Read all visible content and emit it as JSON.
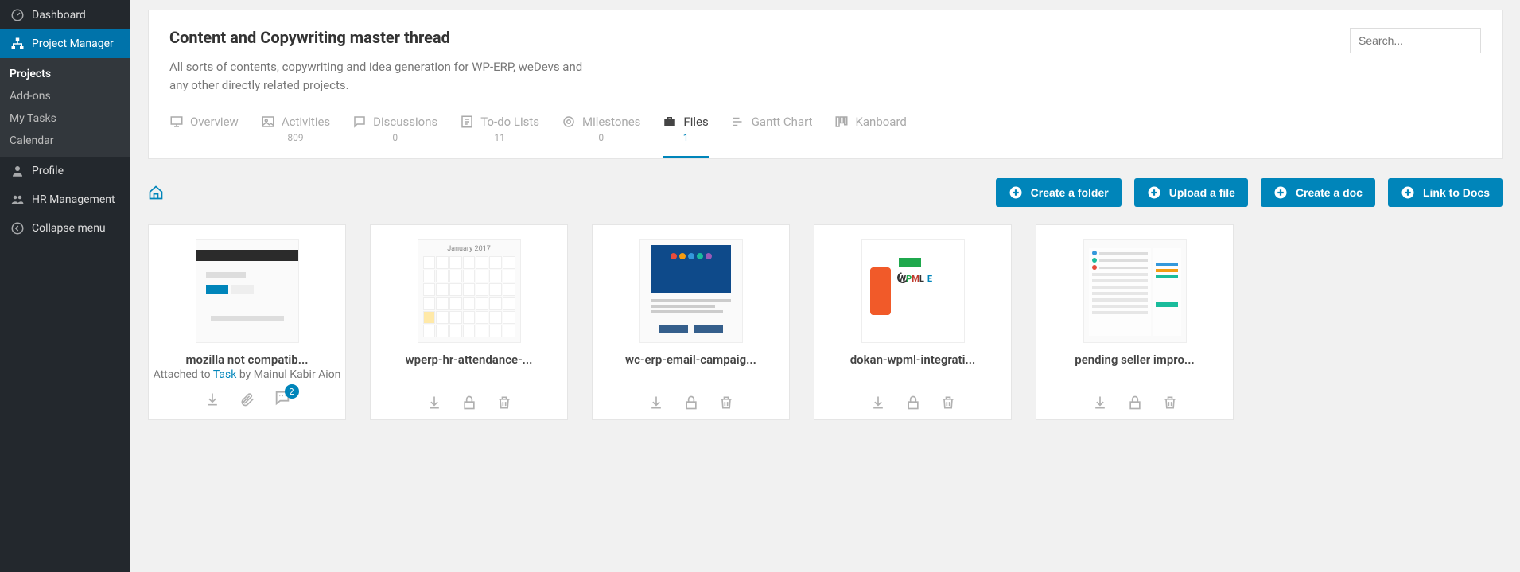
{
  "sidebar": {
    "items": [
      {
        "label": "Dashboard"
      },
      {
        "label": "Project Manager"
      },
      {
        "label": "Profile"
      },
      {
        "label": "HR Management"
      },
      {
        "label": "Collapse menu"
      }
    ],
    "submenu": {
      "items": [
        {
          "label": "Projects"
        },
        {
          "label": "Add-ons"
        },
        {
          "label": "My Tasks"
        },
        {
          "label": "Calendar"
        }
      ]
    }
  },
  "header": {
    "title": "Content and Copywriting master thread",
    "description": "All sorts of contents, copywriting and idea generation for WP-ERP, weDevs and any other directly related projects.",
    "search_placeholder": "Search..."
  },
  "tabs": [
    {
      "label": "Overview",
      "count": ""
    },
    {
      "label": "Activities",
      "count": "809"
    },
    {
      "label": "Discussions",
      "count": "0"
    },
    {
      "label": "To-do Lists",
      "count": "11"
    },
    {
      "label": "Milestones",
      "count": "0"
    },
    {
      "label": "Files",
      "count": "1"
    },
    {
      "label": "Gantt Chart",
      "count": ""
    },
    {
      "label": "Kanboard",
      "count": ""
    }
  ],
  "toolbar": {
    "create_folder": "Create a folder",
    "upload_file": "Upload a file",
    "create_doc": "Create a doc",
    "link_docs": "Link to Docs"
  },
  "files": [
    {
      "title": "mozilla not compatib...",
      "attached_prefix": "Attached to ",
      "attached_link": "Task",
      "attached_by": " by Mainul Kabir Aion",
      "comment_count": "2"
    },
    {
      "title": "wperp-hr-attendance-..."
    },
    {
      "title": "wc-erp-email-campaig..."
    },
    {
      "title": "dokan-wpml-integrati..."
    },
    {
      "title": "pending seller impro..."
    }
  ],
  "thumb2_caption": "January 2017"
}
